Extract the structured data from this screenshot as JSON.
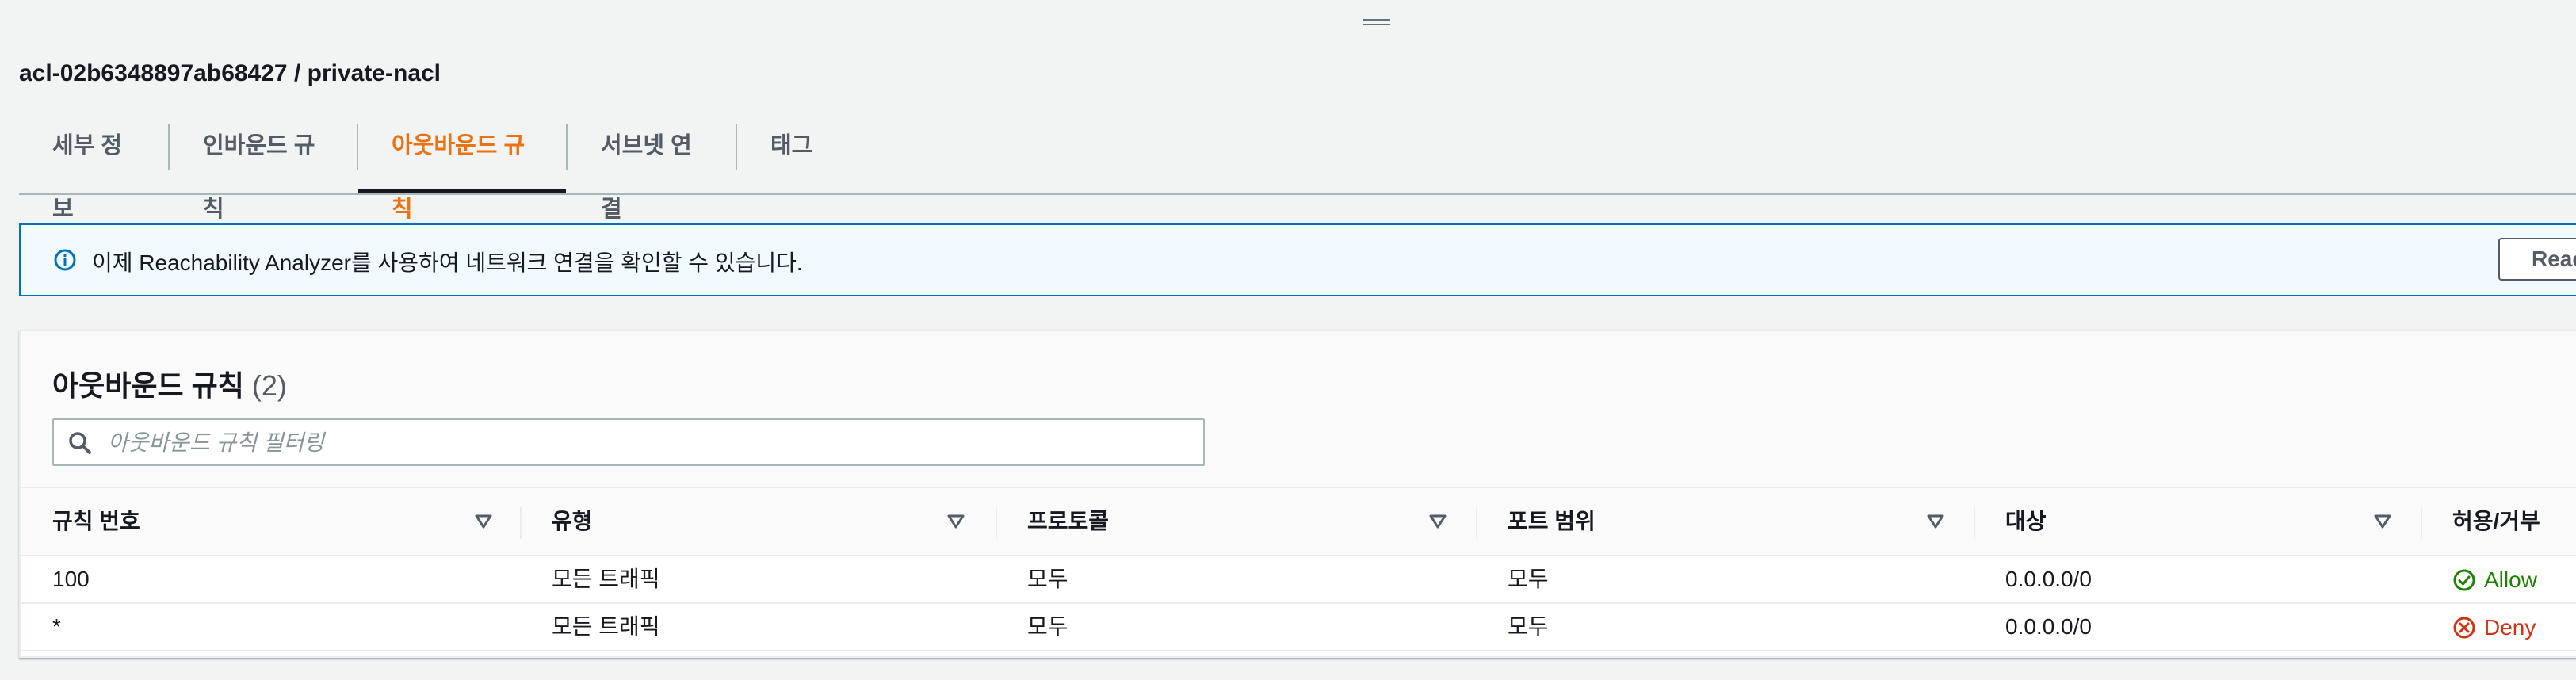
{
  "header": {
    "title": "acl-02b6348897ab68427 / private-nacl"
  },
  "tabs": [
    {
      "label": "세부 정보",
      "active": false
    },
    {
      "label": "인바운드 규칙",
      "active": false
    },
    {
      "label": "아웃바운드 규칙",
      "active": true
    },
    {
      "label": "서브넷 연결",
      "active": false
    },
    {
      "label": "태그",
      "active": false
    }
  ],
  "alert": {
    "icon": "info-icon",
    "message": "이제 Reachability Analyzer를 사용하여 네트워크 연결을 확인할 수 있습니다.",
    "button_label": "Reac"
  },
  "rules_panel": {
    "title": "아웃바운드 규칙",
    "count": "(2)",
    "search_placeholder": "아웃바운드 규칙 필터링",
    "search_value": "",
    "columns": [
      "규칙 번호",
      "유형",
      "프로토콜",
      "포트 범위",
      "대상",
      "허용/거부"
    ],
    "rows": [
      {
        "rule_number": "100",
        "type": "모든 트래픽",
        "protocol": "모두",
        "port_range": "모두",
        "destination": "0.0.0.0/0",
        "action": "Allow",
        "action_icon": "check-circle-icon"
      },
      {
        "rule_number": "*",
        "type": "모든 트래픽",
        "protocol": "모두",
        "port_range": "모두",
        "destination": "0.0.0.0/0",
        "action": "Deny",
        "action_icon": "x-circle-icon"
      }
    ]
  },
  "colors": {
    "accent": "#ec7211",
    "info_border": "#0073bb",
    "info_bg": "#f1faff",
    "allow": "#1d8102",
    "deny": "#d13212"
  }
}
